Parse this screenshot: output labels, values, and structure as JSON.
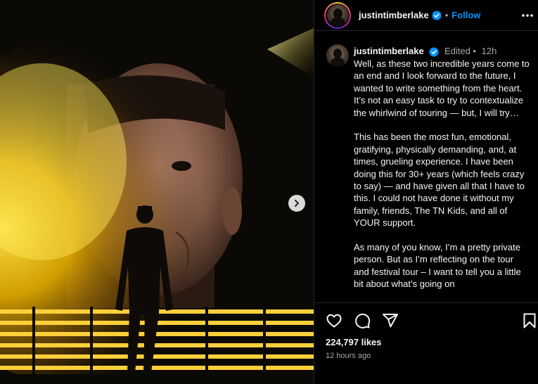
{
  "post": {
    "username": "justintimberlake",
    "separator": "•",
    "follow_label": "Follow",
    "media_alt": "Performer silhouetted on stage in front of a giant screen with his face and yellow smoke"
  },
  "caption": {
    "username": "justintimberlake",
    "edited_label": "Edited •",
    "time": "12h",
    "paragraphs": [
      "Well, as these two incredible years come to an end and I look forward to the future, I wanted to write something from the heart. It’s not an easy task to try to contextualize the whirlwind of touring — but, I will try…",
      "This has been the most fun, emotional, gratifying, physically demanding, and, at times, grueling experience. I have been doing this for 30+ years (which feels crazy to say) — and have given all that I have to this. I could not have done it without my family, friends, The TN Kids, and all of YOUR support.",
      "As many of you know, I’m a pretty private person. But as I’m reflecting on the tour and festival tour – I want to tell you a little bit about what’s going on"
    ]
  },
  "stats": {
    "likes": "224,797 likes",
    "timestamp": "12 hours ago"
  },
  "icons": {
    "verified": "verified-badge-icon",
    "more": "more-options-icon",
    "like": "heart-icon",
    "comment": "comment-icon",
    "share": "share-icon",
    "save": "bookmark-icon",
    "next": "chevron-right-icon"
  },
  "colors": {
    "accent": "#0095f6",
    "secondary_text": "#a8a8a8",
    "divider": "#262626"
  }
}
